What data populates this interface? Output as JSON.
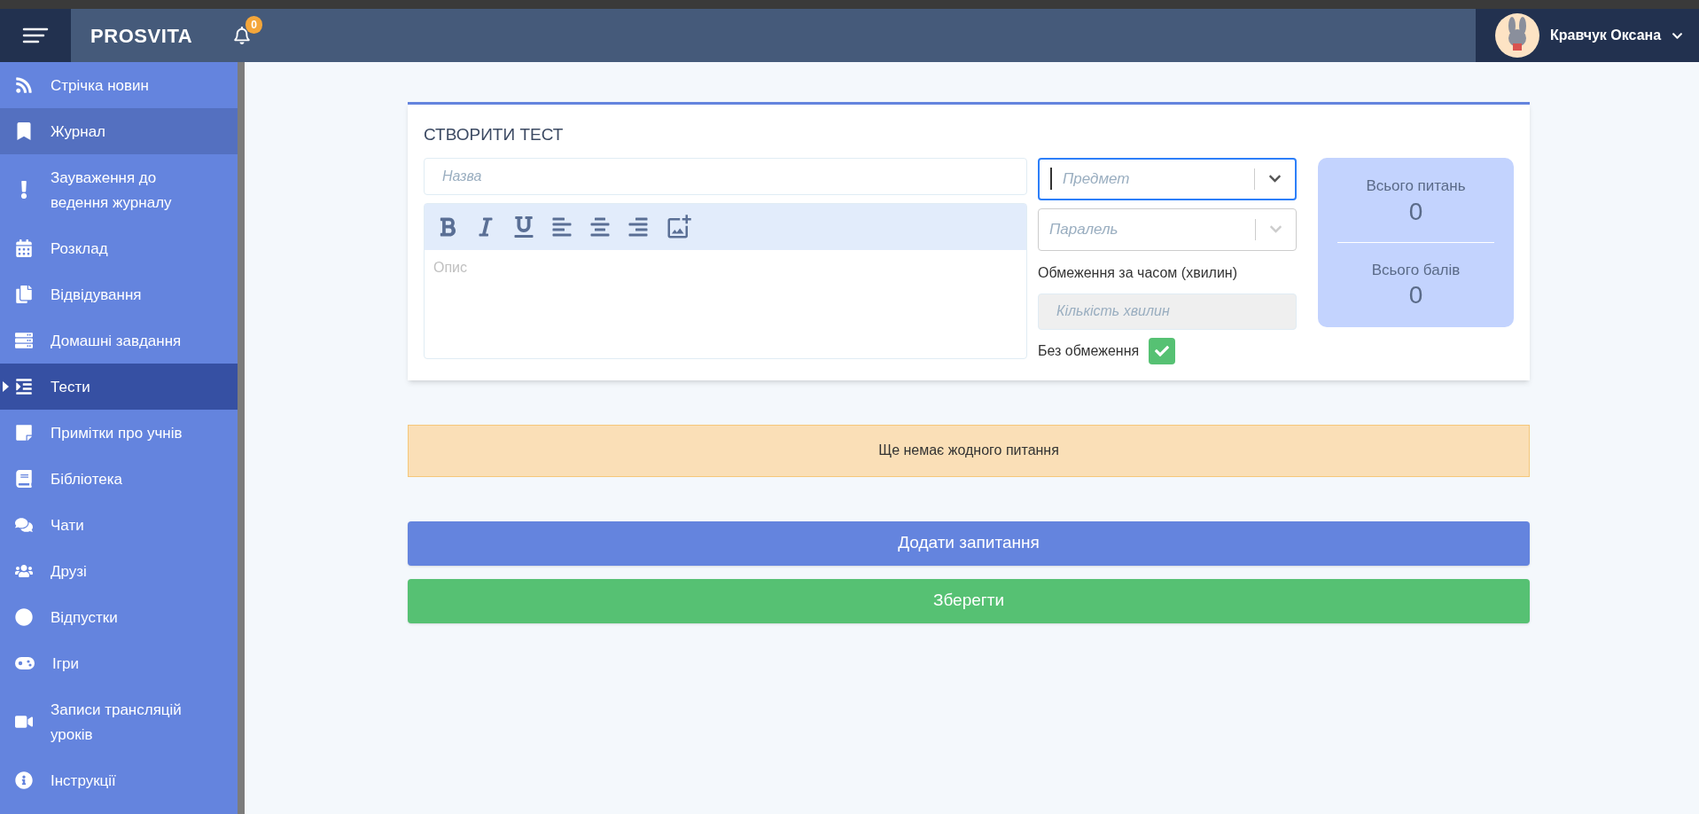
{
  "header": {
    "logo": "PROSVITA",
    "notifications": "0",
    "user": "Кравчук Оксана"
  },
  "sidebar": {
    "items": [
      {
        "label": "Стрічка новин",
        "selected": false,
        "highlighted": false
      },
      {
        "label": "Журнал",
        "selected": false,
        "highlighted": true
      },
      {
        "label": "Зауваження до ведення журналу",
        "selected": false,
        "highlighted": false
      },
      {
        "label": "Розклад",
        "selected": false,
        "highlighted": false
      },
      {
        "label": "Відвідування",
        "selected": false,
        "highlighted": false
      },
      {
        "label": "Домашні завдання",
        "selected": false,
        "highlighted": false
      },
      {
        "label": "Тести",
        "selected": true,
        "highlighted": false
      },
      {
        "label": "Примітки про учнів",
        "selected": false,
        "highlighted": false
      },
      {
        "label": "Бібліотека",
        "selected": false,
        "highlighted": false
      },
      {
        "label": "Чати",
        "selected": false,
        "highlighted": false
      },
      {
        "label": "Друзі",
        "selected": false,
        "highlighted": false
      },
      {
        "label": "Відпустки",
        "selected": false,
        "highlighted": false
      },
      {
        "label": "Ігри",
        "selected": false,
        "highlighted": false
      },
      {
        "label": "Записи трансляцій уроків",
        "selected": false,
        "highlighted": false
      },
      {
        "label": "Інструкції",
        "selected": false,
        "highlighted": false
      }
    ]
  },
  "form": {
    "title": "СТВОРИТИ ТЕСТ",
    "name": {
      "placeholder": "Назва"
    },
    "description": {
      "placeholder": "Опис"
    },
    "subject": {
      "placeholder": "Предмет",
      "focused": true
    },
    "parallel": {
      "placeholder": "Паралель"
    },
    "time_limit_label": "Обмеження за часом (хвилин)",
    "minutes": {
      "placeholder": "Кількість хвилин",
      "disabled": true
    },
    "no_limit": {
      "label": "Без обмеження",
      "checked": true
    },
    "stats": [
      {
        "label": "Всього питань",
        "value": "0"
      },
      {
        "label": "Всього балів",
        "value": "0"
      }
    ]
  },
  "alert": "Ще немає жодного питання",
  "buttons": [
    {
      "label": "Додати запитання",
      "kind": "primary"
    },
    {
      "label": "Зберегти",
      "kind": "success"
    }
  ]
}
